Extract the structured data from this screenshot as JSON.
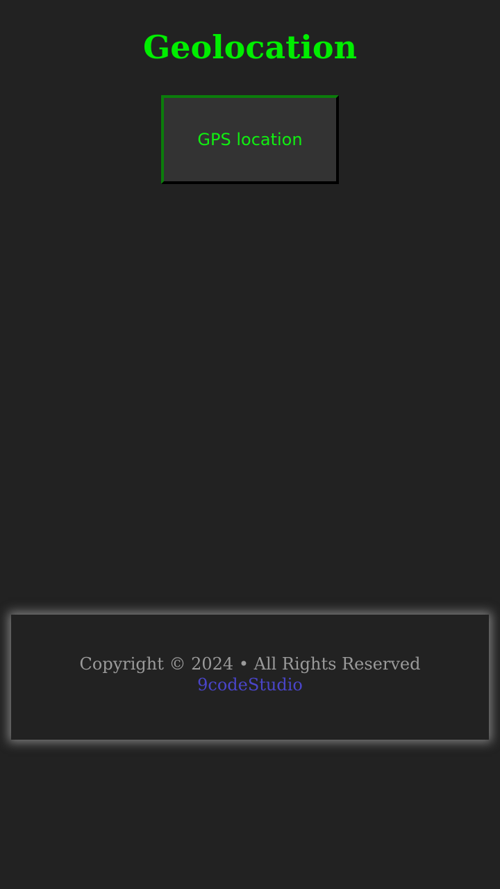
{
  "header": {
    "title": "Geolocation"
  },
  "main": {
    "gps_button_label": "GPS location"
  },
  "footer": {
    "copyright": "Copyright © 2024 • All Rights Reserved",
    "studio_link": "9codeStudio"
  },
  "colors": {
    "background": "#222222",
    "accent_green": "#00ee00",
    "button_bg": "#333333",
    "footer_text": "#9a9a9a",
    "link": "#4a45c9"
  }
}
